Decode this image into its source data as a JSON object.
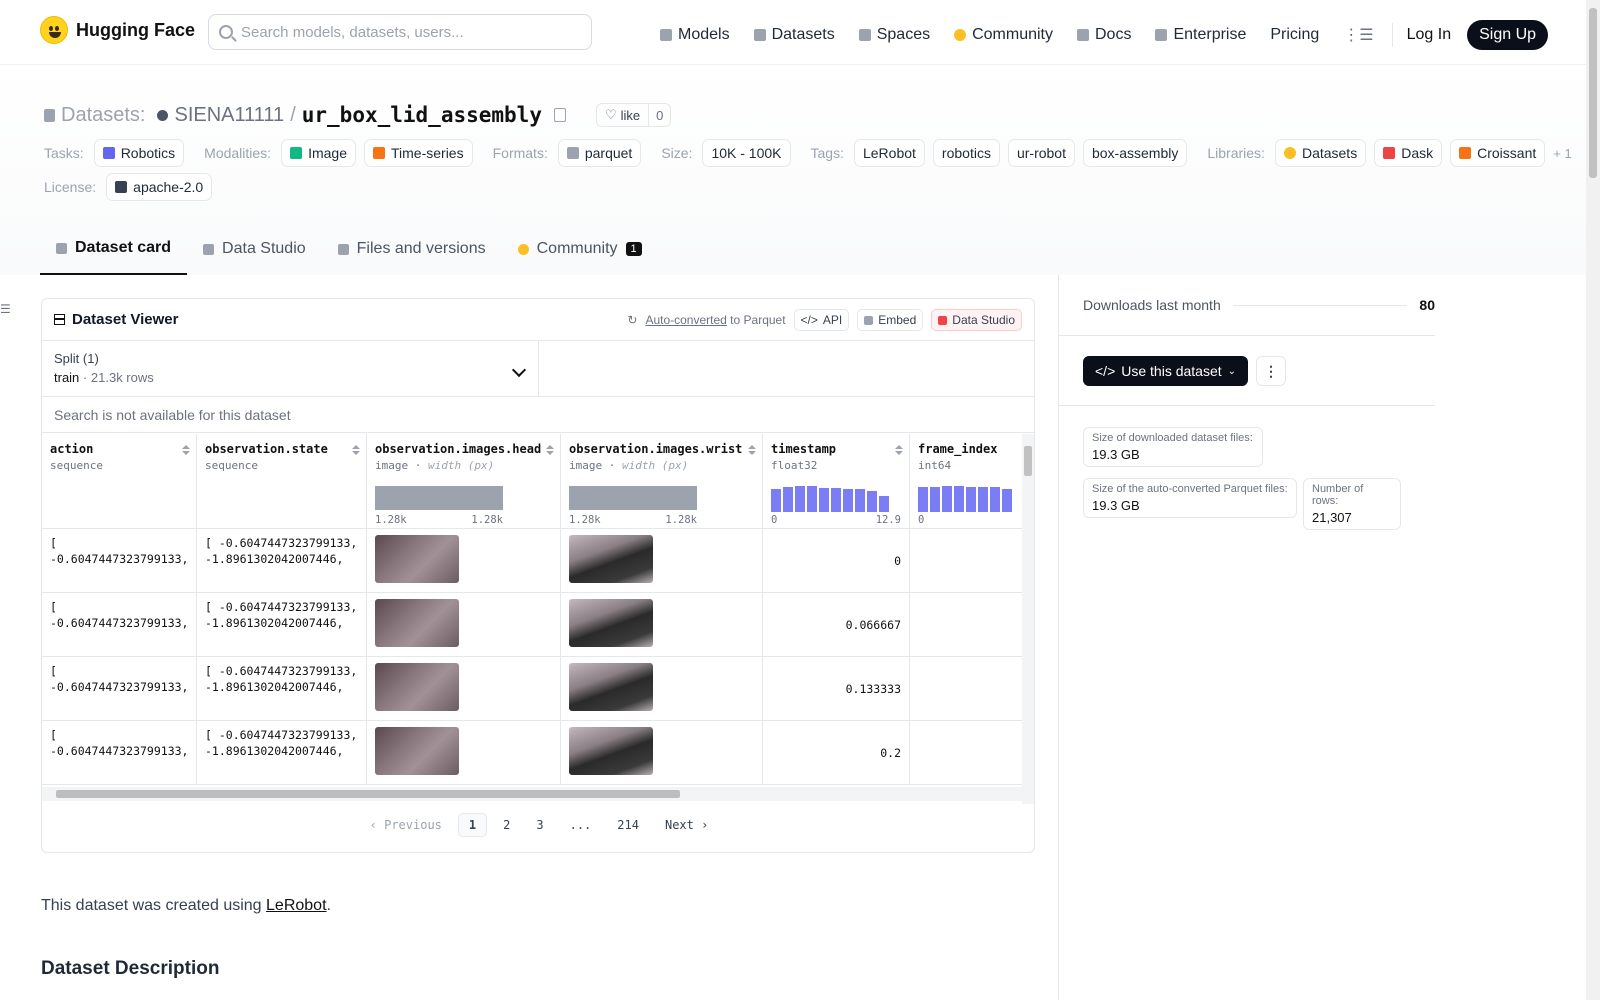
{
  "header": {
    "logo_text": "Hugging Face",
    "search_placeholder": "Search models, datasets, users...",
    "nav": [
      "Models",
      "Datasets",
      "Spaces",
      "Community",
      "Docs",
      "Enterprise",
      "Pricing"
    ],
    "login": "Log In",
    "signup": "Sign Up"
  },
  "dataset": {
    "section": "Datasets:",
    "owner": "SIENA11111",
    "slash": "/",
    "name": "ur_box_lid_assembly",
    "like_label": "like",
    "like_count": "0"
  },
  "tags": {
    "tasks_label": "Tasks:",
    "tasks": [
      "Robotics"
    ],
    "modalities_label": "Modalities:",
    "modalities": [
      "Image",
      "Time-series"
    ],
    "formats_label": "Formats:",
    "formats": [
      "parquet"
    ],
    "size_label": "Size:",
    "size": "10K - 100K",
    "tags_label": "Tags:",
    "tags": [
      "LeRobot",
      "robotics",
      "ur-robot",
      "box-assembly"
    ],
    "libraries_label": "Libraries:",
    "libraries": [
      "Datasets",
      "Dask",
      "Croissant"
    ],
    "libraries_more": "+ 1",
    "license_label": "License:",
    "license": "apache-2.0"
  },
  "tabs": [
    {
      "label": "Dataset card"
    },
    {
      "label": "Data Studio"
    },
    {
      "label": "Files and versions"
    },
    {
      "label": "Community",
      "badge": "1"
    }
  ],
  "viewer": {
    "title": "Dataset Viewer",
    "autoconv": "Auto-converted",
    "to_parquet": "to Parquet",
    "api": "API",
    "embed": "Embed",
    "studio": "Data Studio",
    "split_label": "Split (1)",
    "split_name": "train",
    "split_sep": "·",
    "split_rows": "21.3k rows",
    "search_na": "Search is not available for this dataset",
    "columns": [
      {
        "name": "action",
        "type": "sequence"
      },
      {
        "name": "observation.state",
        "type": "sequence"
      },
      {
        "name": "observation.images.head",
        "type": "image",
        "extra": "width (px)",
        "min": "1.28k",
        "max": "1.28k"
      },
      {
        "name": "observation.images.wrist",
        "type": "image",
        "extra": "width (px)",
        "min": "1.28k",
        "max": "1.28k"
      },
      {
        "name": "timestamp",
        "type": "float32",
        "min": "0",
        "max": "12.9"
      },
      {
        "name": "frame_index",
        "type": "int64",
        "min": "0"
      }
    ],
    "type_sep": "·",
    "histograms": {
      "timestamp": [
        0.9,
        0.95,
        1,
        1,
        0.92,
        0.92,
        0.9,
        0.88,
        0.82,
        0.6
      ],
      "frame_index": [
        0.95,
        0.95,
        1,
        1,
        0.95,
        0.95,
        0.95,
        0.9
      ]
    },
    "rows": [
      {
        "action": [
          "[",
          "-0.6047447323799133,"
        ],
        "state": [
          "[ -0.6047447323799133,",
          "-1.8961302042007446,"
        ],
        "timestamp": "0"
      },
      {
        "action": [
          "[",
          "-0.6047447323799133,"
        ],
        "state": [
          "[ -0.6047447323799133,",
          "-1.8961302042007446,"
        ],
        "timestamp": "0.066667"
      },
      {
        "action": [
          "[",
          "-0.6047447323799133,"
        ],
        "state": [
          "[ -0.6047447323799133,",
          "-1.8961302042007446,"
        ],
        "timestamp": "0.133333"
      },
      {
        "action": [
          "[",
          "-0.6047447323799133,"
        ],
        "state": [
          "[ -0.6047447323799133,",
          "-1.8961302042007446,"
        ],
        "timestamp": "0.2"
      }
    ],
    "pager": {
      "prev": "Previous",
      "pages": [
        "1",
        "2",
        "3",
        "...",
        "214"
      ],
      "next": "Next"
    }
  },
  "sidebar": {
    "downloads_label": "Downloads last month",
    "downloads": "80",
    "use_btn": "Use this dataset",
    "dl_files_label": "Size of downloaded dataset files:",
    "dl_files": "19.3 GB",
    "parquet_label": "Size of the auto-converted Parquet files:",
    "parquet": "19.3 GB",
    "rows_label": "Number of rows:",
    "rows": "21,307"
  },
  "card": {
    "created_prefix": "This dataset was created using ",
    "created_link": "LeRobot",
    "created_suffix": ".",
    "desc_heading": "Dataset Description"
  },
  "colors": {
    "accent": "#6366f1",
    "dark": "#0b0f19",
    "bar_gray": "#9ca3af"
  }
}
